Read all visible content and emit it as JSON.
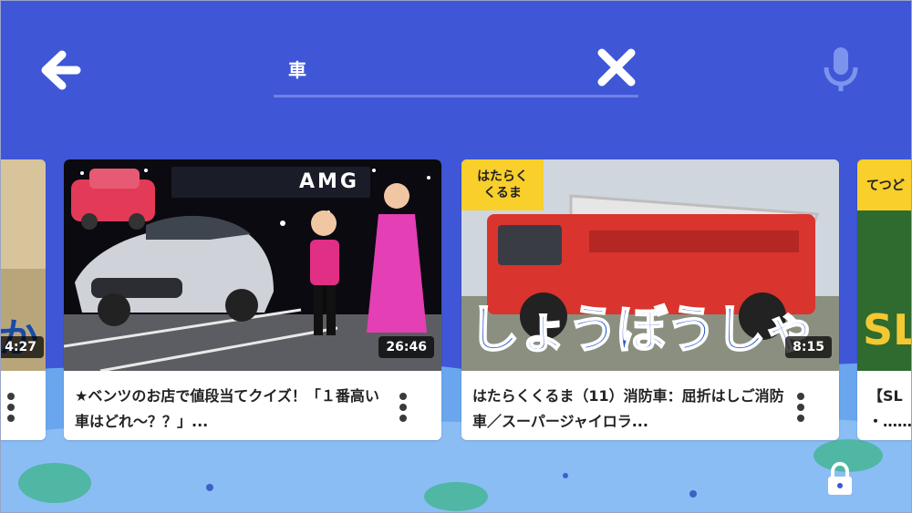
{
  "search": {
    "query": "車"
  },
  "icons": {
    "back": "arrow-left-icon",
    "clear": "close-icon",
    "mic": "microphone-icon",
    "more": "more-vertical-icon",
    "lock": "lock-icon"
  },
  "colors": {
    "top_bar": "#3f57d6",
    "scene_light": "#7fb3f2",
    "card_bg": "#ffffff",
    "badge_yellow": "#f8cf2b"
  },
  "cards": [
    {
      "title": "",
      "duration": "4:27",
      "thumb_text": "か"
    },
    {
      "title": "★ベンツのお店で値段当てクイズ！「１番高い車はどれ〜？？」...",
      "duration": "26:46",
      "thumb_text": "AMG"
    },
    {
      "title": "はたらくくるま（11）消防車：屈折はしご消防車／スーパージャイロラ...",
      "duration": "8:15",
      "badge": "はたらく\nくるま",
      "thumb_text": "しょうぼうしゃ"
    },
    {
      "title": "【SL ・…とめ",
      "badge": "てつど",
      "thumb_text": "SL"
    }
  ]
}
